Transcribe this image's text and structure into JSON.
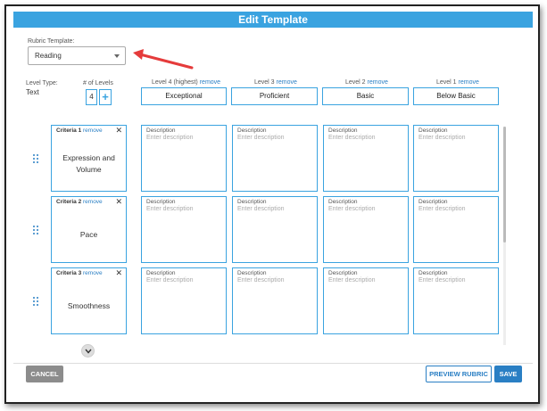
{
  "modal": {
    "title": "Edit Template"
  },
  "rubric_template": {
    "label": "Rubric Template:",
    "selected": "Reading"
  },
  "level_type": {
    "label": "Level Type:",
    "value": "Text"
  },
  "num_levels": {
    "label": "# of Levels",
    "value": "4",
    "add_symbol": "+"
  },
  "remove_label": "remove",
  "levels": [
    {
      "header": "Level 4 (highest)",
      "name": "Exceptional"
    },
    {
      "header": "Level 3",
      "name": "Proficient"
    },
    {
      "header": "Level 2",
      "name": "Basic"
    },
    {
      "header": "Level 1",
      "name": "Below Basic"
    }
  ],
  "criteria": [
    {
      "label": "Criteria 1",
      "name": "Expression and Volume"
    },
    {
      "label": "Criteria 2",
      "name": "Pace"
    },
    {
      "label": "Criteria 3",
      "name": "Smoothness"
    }
  ],
  "description": {
    "label": "Description",
    "placeholder": "Enter description"
  },
  "close_symbol": "✕",
  "footer": {
    "cancel": "CANCEL",
    "preview": "PREVIEW RUBRIC",
    "save": "SAVE"
  },
  "colors": {
    "accent": "#3aa3e0",
    "primary": "#2a7fc4",
    "arrow": "#e53b3b",
    "cancel": "#8c8c8c"
  }
}
